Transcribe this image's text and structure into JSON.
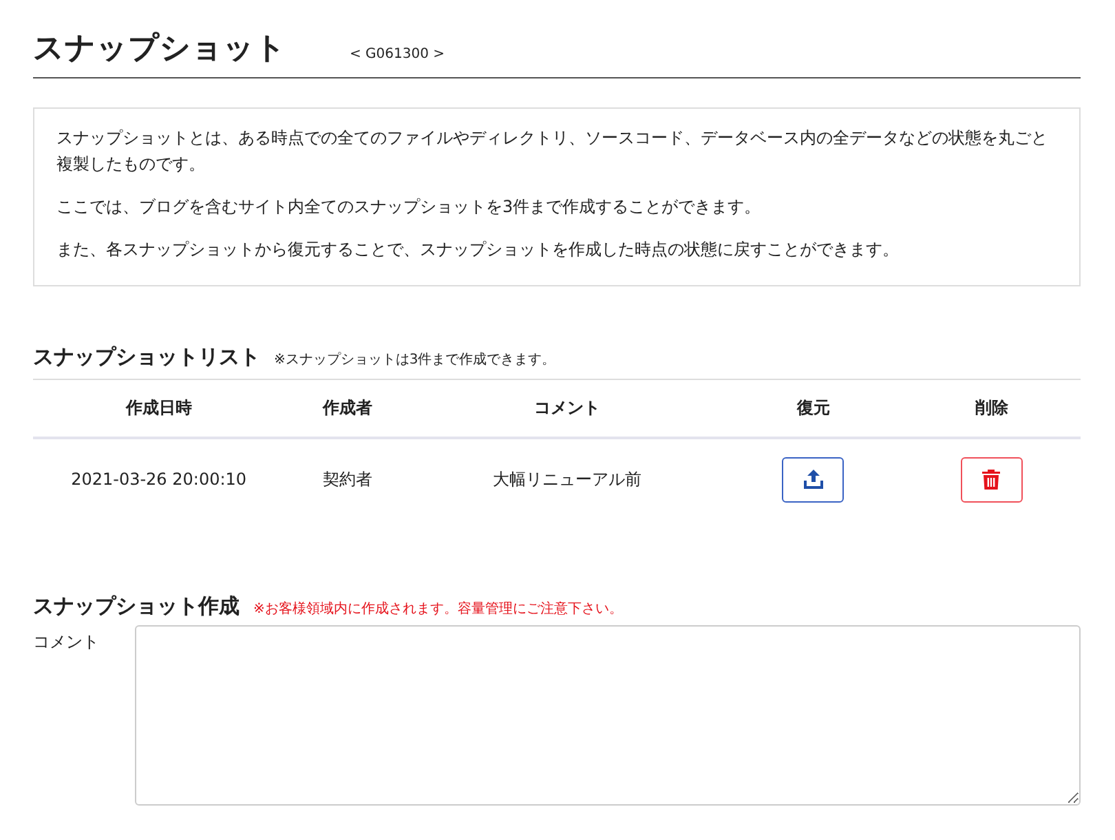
{
  "page": {
    "title": "スナップショット",
    "code": "< G061300 >"
  },
  "info": [
    "スナップショットとは、ある時点での全てのファイルやディレクトリ、ソースコード、データベース内の全データなどの状態を丸ごと複製したものです。",
    "ここでは、ブログを含むサイト内全てのスナップショットを3件まで作成することができます。",
    "また、各スナップショットから復元することで、スナップショットを作成した時点の状態に戻すことができます。"
  ],
  "snapshot_list": {
    "title": "スナップショットリスト",
    "note": "※スナップショットは3件まで作成できます。",
    "columns": [
      "作成日時",
      "作成者",
      "コメント",
      "復元",
      "削除"
    ],
    "rows": [
      {
        "created_at": "2021-03-26 20:00:10",
        "creator": "契約者",
        "comment": "大幅リニューアル前"
      }
    ]
  },
  "create": {
    "title": "スナップショット作成",
    "warning": "※お客様領域内に作成されます。容量管理にご注意下さい。",
    "comment_label": "コメント"
  }
}
